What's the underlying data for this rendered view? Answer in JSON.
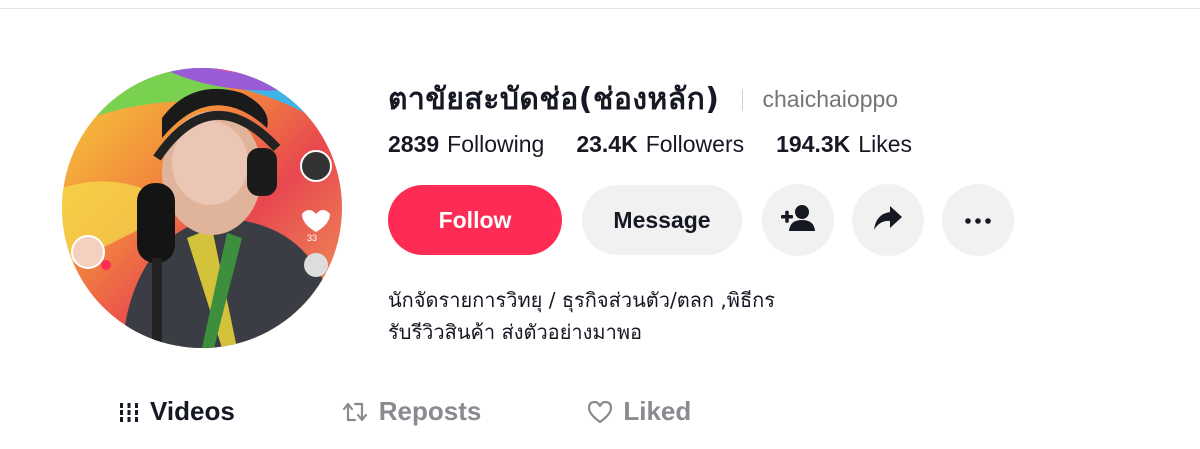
{
  "profile": {
    "display_name": "ตาขัยสะบัดช่อ(ช่องหลัก)",
    "username": "chaichaioppo",
    "avatar_reaction_count": "33"
  },
  "stats": [
    {
      "value": "2839",
      "label": "Following"
    },
    {
      "value": "23.4K",
      "label": "Followers"
    },
    {
      "value": "194.3K",
      "label": "Likes"
    }
  ],
  "actions": {
    "follow_label": "Follow",
    "message_label": "Message",
    "add_friend_icon": "person-plus-icon",
    "share_icon": "share-arrow-icon",
    "more_icon": "ellipsis-icon"
  },
  "bio": {
    "line1": "นักจัดรายการวิทยุ / ธุรกิจส่วนตัว/ตลก ,พิธีกร",
    "line2": "รับรีวิวสินค้า ส่งตัวอย่างมาพอ"
  },
  "tabs": [
    {
      "label": "Videos",
      "icon": "grid-icon",
      "active": true
    },
    {
      "label": "Reposts",
      "icon": "repost-icon",
      "active": false
    },
    {
      "label": "Liked",
      "icon": "heart-outline-icon",
      "active": false
    }
  ],
  "colors": {
    "accent": "#fe2c55",
    "button_bg": "#f1f1f2",
    "text_primary": "#161823",
    "text_secondary": "#757575"
  }
}
